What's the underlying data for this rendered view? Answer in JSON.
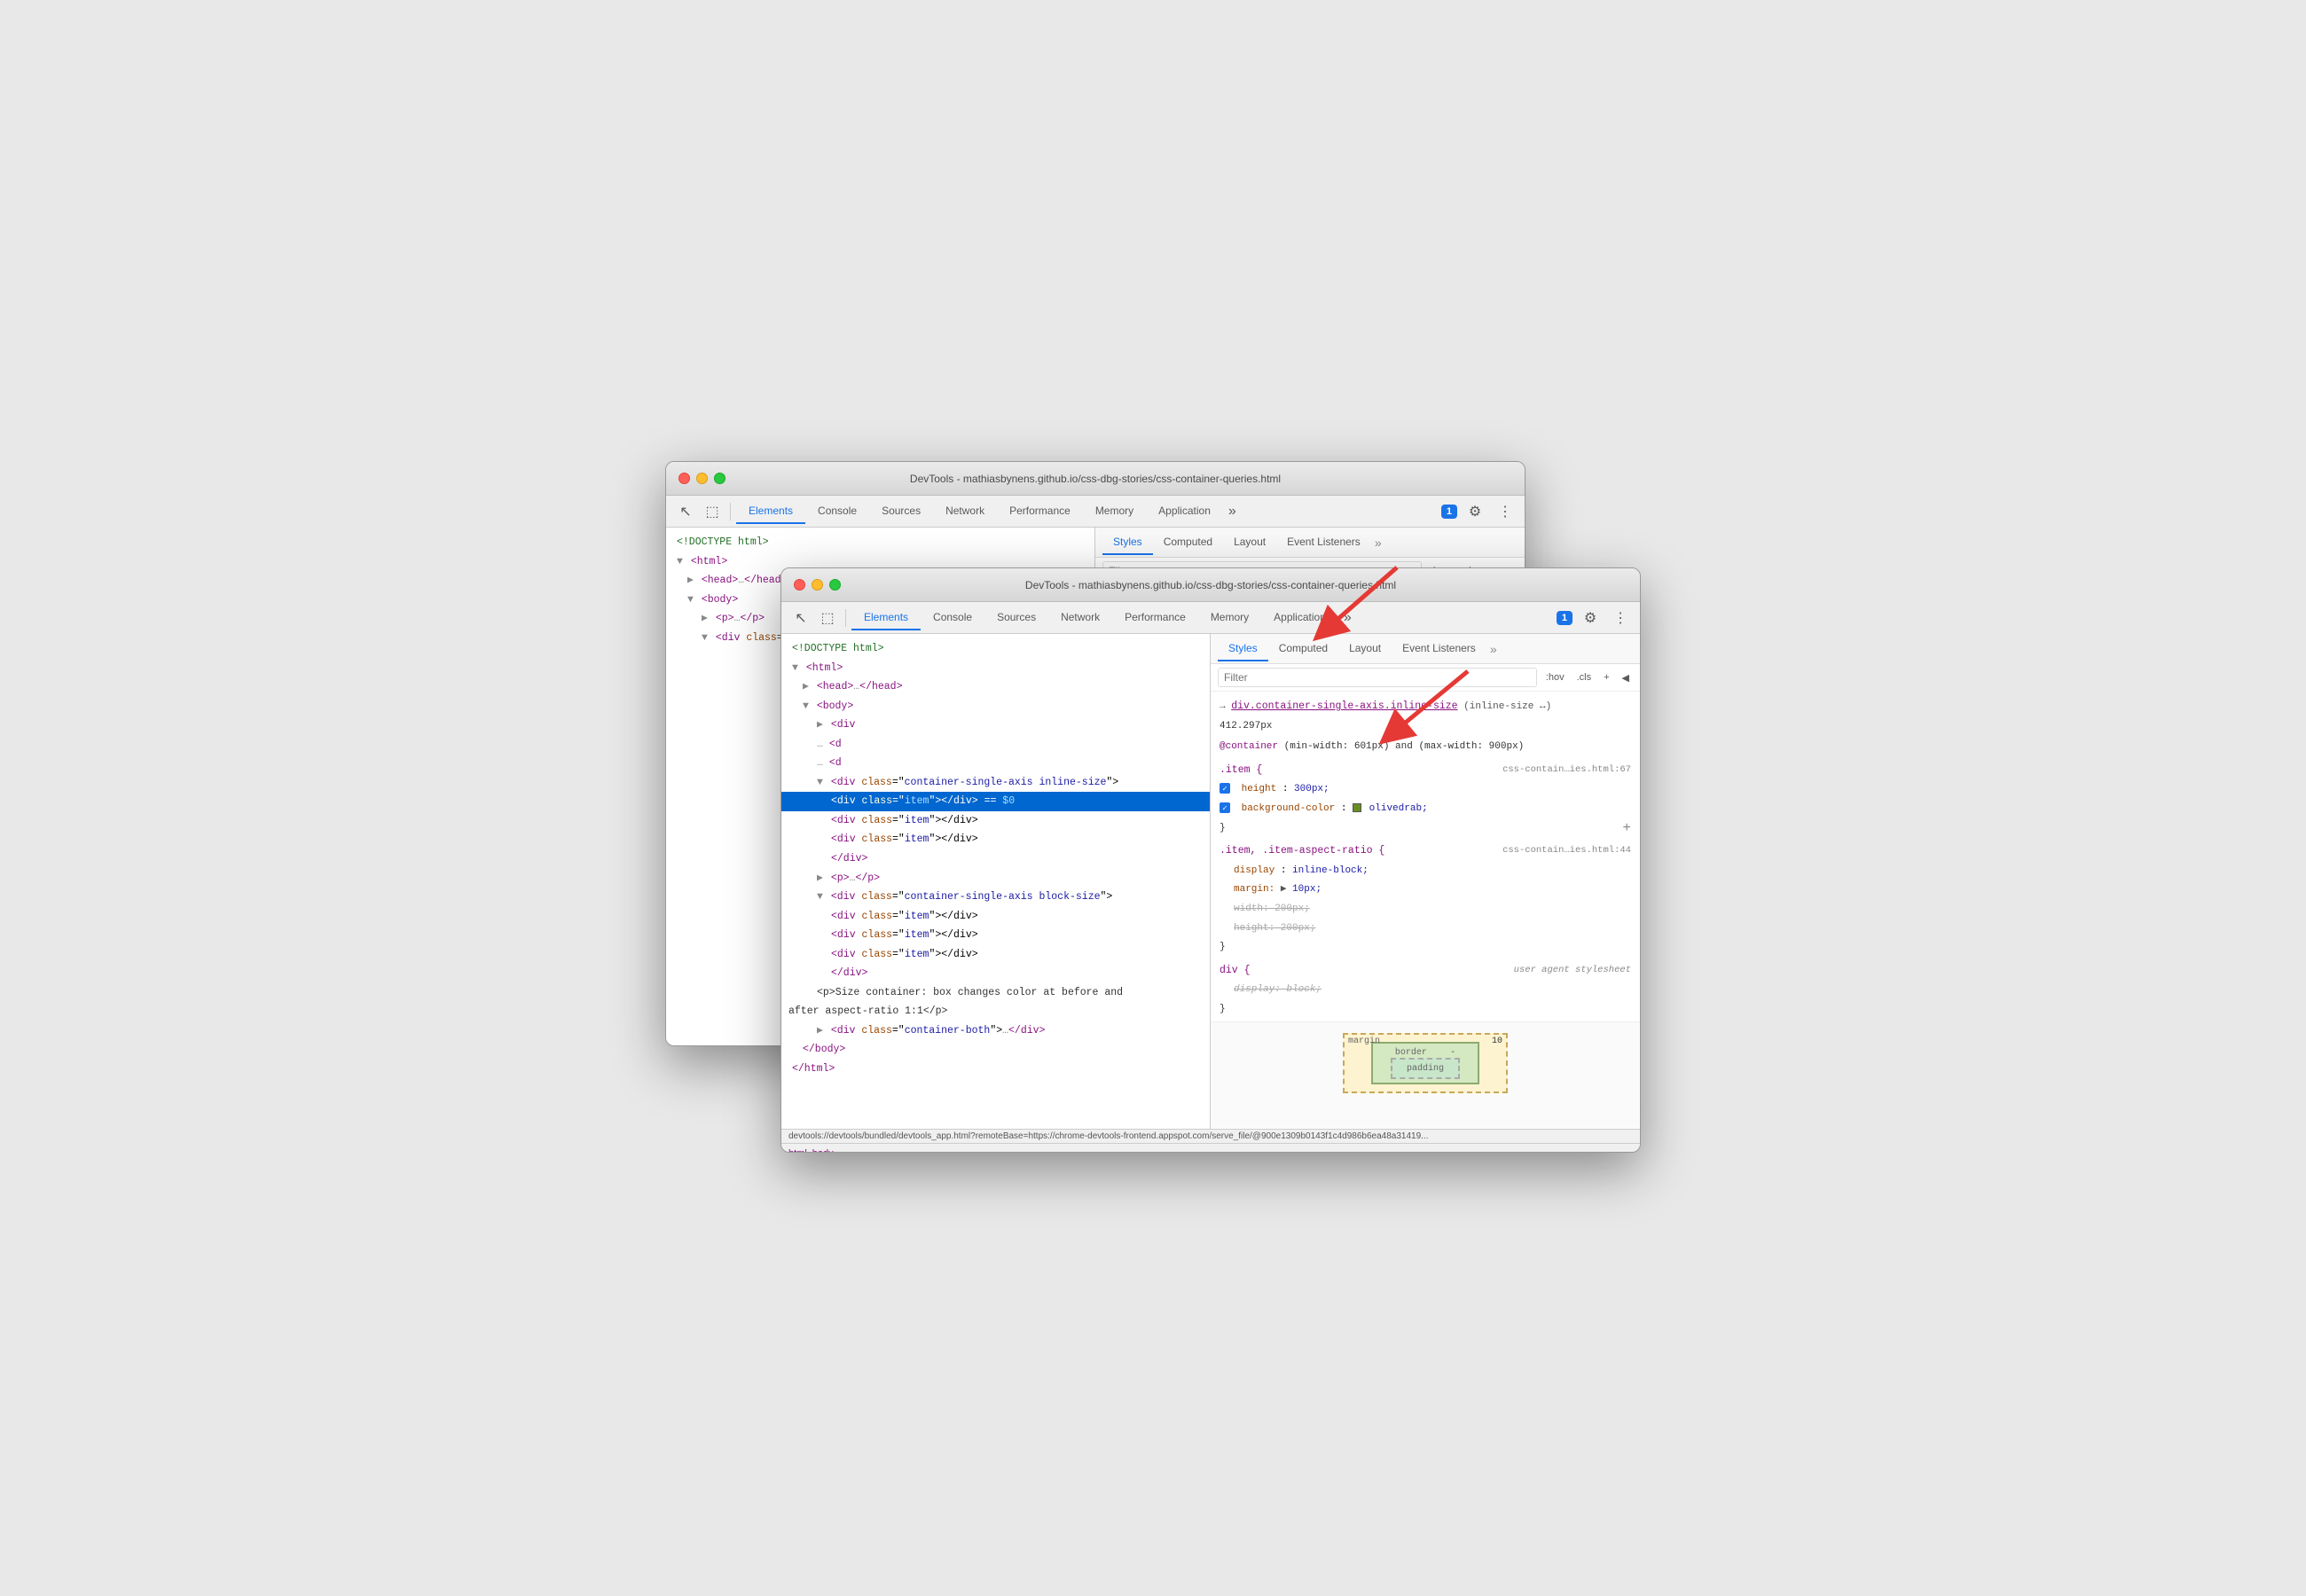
{
  "windows": {
    "back": {
      "title": "DevTools - mathiasbynens.github.io/css-dbg-stories/css-container-queries.html",
      "tabs": [
        "Elements",
        "Console",
        "Sources",
        "Network",
        "Performance",
        "Memory",
        "Application"
      ],
      "active_tab": "Elements",
      "style_tabs": [
        "Styles",
        "Computed",
        "Layout",
        "Event Listeners"
      ],
      "active_style_tab": "Styles",
      "filter_placeholder": "Filter",
      "filter_pseudo": ":hov",
      "filter_cls": ".cls",
      "dom_lines": [
        {
          "text": "<!DOCTYPE html>",
          "indent": 0,
          "type": "comment"
        },
        {
          "text": "<html>",
          "indent": 0,
          "type": "tag"
        },
        {
          "text": "<head>…</head>",
          "indent": 1,
          "type": "tag",
          "expand": true
        },
        {
          "text": "<body>",
          "indent": 1,
          "type": "tag"
        },
        {
          "text": "<p>…</p>",
          "indent": 2,
          "type": "tag"
        },
        {
          "text": "<div class=\"container-single-axis inline-size\">",
          "indent": 2,
          "type": "tag",
          "expand": true
        }
      ],
      "styles": {
        "selector1": "div.container-single-axis.i…size",
        "selector1_full": "div.container-single-axis.inline-size",
        "at_rule": "@container (min-width: 601px) and (max-width: 900px)",
        "rule1": ".item {",
        "file1": "css-contain…ies.html:67"
      }
    },
    "front": {
      "title": "DevTools - mathiasbynens.github.io/css-dbg-stories/css-container-queries.html",
      "tabs": [
        "Elements",
        "Console",
        "Sources",
        "Network",
        "Performance",
        "Memory",
        "Application"
      ],
      "active_tab": "Elements",
      "style_tabs": [
        "Styles",
        "Computed",
        "Layout",
        "Event Listeners"
      ],
      "active_style_tab": "Styles",
      "filter_placeholder": "Filter",
      "filter_pseudo": ":hov",
      "filter_cls": ".cls",
      "dom_lines": [
        {
          "text": "<!DOCTYPE html>",
          "indent": 0,
          "type": "comment"
        },
        {
          "text": "<html>",
          "indent": 0,
          "type": "tag"
        },
        {
          "text": "<head>…</head>",
          "indent": 1,
          "type": "tag",
          "expand": true
        },
        {
          "text": "<body>",
          "indent": 1,
          "type": "tag"
        },
        {
          "text": "<div",
          "indent": 2,
          "type": "tag"
        },
        {
          "text": "<d",
          "indent": 2
        },
        {
          "text": "<d",
          "indent": 2
        },
        {
          "text": "<div class=\"container-single-axis inline-size\">",
          "indent": 2,
          "type": "tag"
        },
        {
          "text": "<div class=\"item\"></div> == $0",
          "indent": 3,
          "type": "selected"
        },
        {
          "text": "<div class=\"item\"></div>",
          "indent": 3,
          "type": "tag"
        },
        {
          "text": "<div class=\"item\"></div>",
          "indent": 3,
          "type": "tag"
        },
        {
          "text": "</div>",
          "indent": 3,
          "type": "tag"
        },
        {
          "text": "<p>…</p>",
          "indent": 2,
          "type": "tag"
        },
        {
          "text": "<div class=\"container-single-axis block-size\">",
          "indent": 2,
          "type": "tag"
        },
        {
          "text": "<div class=\"item\"></div>",
          "indent": 3,
          "type": "tag"
        },
        {
          "text": "<div class=\"item\"></div>",
          "indent": 3,
          "type": "tag"
        },
        {
          "text": "<div class=\"item\"></div>",
          "indent": 3,
          "type": "tag"
        },
        {
          "text": "</div>",
          "indent": 3,
          "type": "tag"
        },
        {
          "text": "<p>Size container: box changes color at before and",
          "indent": 2,
          "type": "text"
        },
        {
          "text": "after aspect-ratio 1:1</p>",
          "indent": 0,
          "type": "text"
        },
        {
          "text": "<div class=\"container-both\">…</div>",
          "indent": 2,
          "type": "tag",
          "expand": true
        },
        {
          "text": "</body>",
          "indent": 1,
          "type": "tag"
        },
        {
          "text": "</html>",
          "indent": 0,
          "type": "tag"
        }
      ],
      "styles": {
        "selector1": "div.container-single-axis.inline-size",
        "selector1_suffix": "(inline-size ↔)",
        "selector1_value": "412.297px",
        "at_rule": "@container (min-width: 601px) and (max-width: 900px)",
        "rule1_selector": ".item {",
        "rule1_file": "css-contain…ies.html:67",
        "rule1_prop1": "height: 300px;",
        "rule1_prop2": "background-color:",
        "rule1_color": "olivedrab",
        "rule2_selector": ".item, .item-aspect-ratio {",
        "rule2_file": "css-contain…ies.html:44",
        "rule2_prop1": "display: inline-block;",
        "rule2_prop2": "margin: ▶ 10px;",
        "rule2_prop3_strike": "width: 200px;",
        "rule2_prop4_strike": "height: 200px;",
        "rule3_selector": "div {",
        "rule3_label": "user agent stylesheet",
        "rule3_prop_strike": "display: block;",
        "box_model": {
          "margin": "10",
          "border": "-",
          "padding": ""
        }
      },
      "bottom_bar": {
        "html": "html",
        "body": "body"
      },
      "url": "devtools://devtools/bundled/devtools_app.html?remoteBase=https://chrome-devtools-frontend.appspot.com/serve_file/@900e1309b0143f1c4d986b6ea48a31419..."
    }
  },
  "icons": {
    "cursor": "↖",
    "rect": "⬚",
    "more_tabs": "»",
    "settings": "⚙",
    "menu": "⋮",
    "close": "✕",
    "minimize": "—",
    "maximize": "⬜",
    "plus": "+",
    "expand_arrow": "▶"
  },
  "chat_badge": "1"
}
